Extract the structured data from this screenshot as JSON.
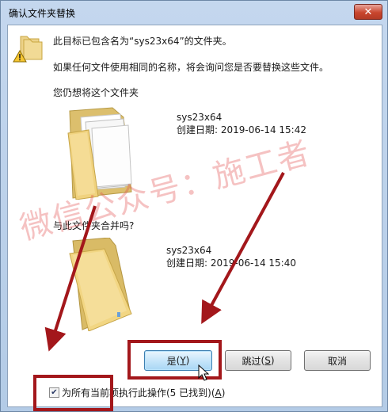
{
  "window": {
    "title": "确认文件夹替换",
    "close_glyph": "✕"
  },
  "message": {
    "line1": "此目标已包含名为“sys23x64”的文件夹。",
    "line2": "如果任何文件使用相同的名称，将会询问您是否要替换这些文件。",
    "line3": "您仍想将这个文件夹"
  },
  "target_folder": {
    "name": "sys23x64",
    "created": "创建日期: 2019-06-14 15:42",
    "icon": "folder-with-files-icon"
  },
  "merge_question": "与此文件夹合并吗?",
  "source_folder": {
    "name": "sys23x64",
    "created": "创建日期: 2019-06-14 15:40",
    "icon": "folder-icon"
  },
  "buttons": {
    "yes_label": "是",
    "yes_key": "Y",
    "skip_label": "跳过",
    "skip_key": "S",
    "cancel_label": "取消"
  },
  "apply_all": {
    "checked": true,
    "label": "为所有当前项执行此操作(5 已找到)",
    "key": "A"
  },
  "watermark": "微信公众号：施工者",
  "annotation_color": "#a3171b",
  "accent_color": "#3c7fb1"
}
